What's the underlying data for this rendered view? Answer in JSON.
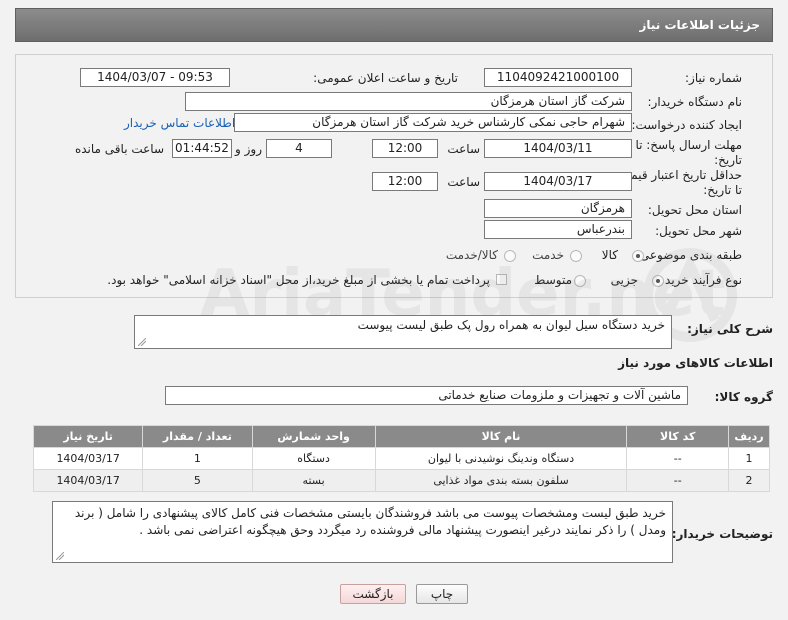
{
  "header": {
    "title": "جزئیات اطلاعات نیاز"
  },
  "form": {
    "need_number_label": "شماره نیاز:",
    "need_number": "1104092421000100",
    "announce_label": "تاریخ و ساعت اعلان عمومی:",
    "announce_value": "1404/03/07 - 09:53",
    "buyer_org_label": "نام دستگاه خریدار:",
    "buyer_org": "شرکت گاز استان هرمزگان",
    "creator_label": "ایجاد کننده درخواست:",
    "creator": "شهرام حاجی نمکی کارشناس خرید شرکت گاز استان هرمزگان",
    "contact_link": "اطلاعات تماس خریدار",
    "deadline_label": "مهلت ارسال پاسخ: تا تاریخ:",
    "deadline_date": "1404/03/11",
    "time_label": "ساعت",
    "deadline_time": "12:00",
    "days_value": "4",
    "days_label": "روز و",
    "remaining_time": "01:44:52",
    "remaining_label": "ساعت باقی مانده",
    "validity_label": "حداقل تاریخ اعتبار قیمت: تا تاریخ:",
    "validity_date": "1404/03/17",
    "validity_time": "12:00",
    "province_label": "استان محل تحویل:",
    "province": "هرمزگان",
    "city_label": "شهر محل تحویل:",
    "city": "بندرعباس",
    "category_label": "طبقه بندی موضوعی:",
    "category_options": [
      "کالا",
      "خدمت",
      "کالا/خدمت"
    ],
    "category_selected": "کالا",
    "process_label": "نوع فرآیند خرید :",
    "process_options": [
      "جزیی",
      "متوسط"
    ],
    "process_selected": "جزیی",
    "payment_note": "پرداخت تمام یا بخشی از مبلغ خرید،از محل \"اسناد خزانه اسلامی\" خواهد بود."
  },
  "summary": {
    "label": "شرح کلی نیاز:",
    "text": "خرید دستگاه سیل لیوان به همراه رول پک طبق لیست پیوست"
  },
  "goods": {
    "section_title": "اطلاعات کالاهای مورد نیاز",
    "group_label": "گروه کالا:",
    "group_value": "ماشین آلات و تجهیزات و ملزومات صنایع خدماتی",
    "columns": [
      "ردیف",
      "کد کالا",
      "نام کالا",
      "واحد شمارش",
      "تعداد / مقدار",
      "تاریخ نیاز"
    ],
    "rows": [
      [
        "1",
        "--",
        "دستگاه وندینگ نوشیدنی با لیوان",
        "دستگاه",
        "1",
        "1404/03/17"
      ],
      [
        "2",
        "--",
        "سلفون بسته بندی مواد غذایی",
        "بسته",
        "5",
        "1404/03/17"
      ]
    ]
  },
  "buyer_notes": {
    "label": "توضیحات خریدار:",
    "text": "خرید طبق لیست ومشخصات پیوست می باشد فروشندگان بایستی مشخصات فنی کامل کالای پیشنهادی را شامل ( برند ومدل ) را ذکر نمایند درغیر اینصورت پیشنهاد مالی فروشنده رد میگردد وحق هیچگونه اعتراضی نمی باشد ."
  },
  "buttons": {
    "print": "چاپ",
    "back": "بازگشت"
  },
  "watermark_text": "AriaTender.net"
}
